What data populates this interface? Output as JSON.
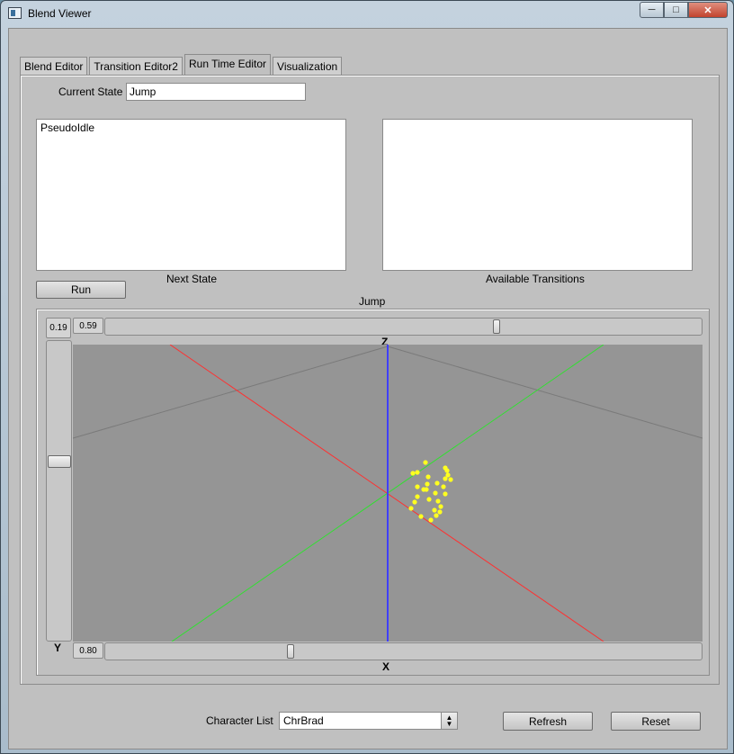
{
  "window": {
    "title": "Blend Viewer",
    "controls": {
      "minimize": "─",
      "maximize": "□",
      "close": "✕"
    }
  },
  "tabs": [
    {
      "label": "Blend Editor",
      "active": false
    },
    {
      "label": "Transition Editor2",
      "active": false
    },
    {
      "label": "Run Time Editor",
      "active": true
    },
    {
      "label": "Visualization",
      "active": false
    }
  ],
  "run_time_editor": {
    "current_state_label": "Current State",
    "current_state_value": "Jump",
    "next_state_list": [
      "PseudoIdle"
    ],
    "next_state_label": "Next State",
    "available_transitions_list": [],
    "available_transitions_label": "Available Transitions",
    "run_button": "Run",
    "viewer_title": "Jump",
    "viewer": {
      "top_left_value": "0.19",
      "z_slider_value": "0.59",
      "z_slider_level": 0.66,
      "y_slider_level": 0.4,
      "x_slider_value": "0.80",
      "x_slider_level": 0.31,
      "axis_z_label": "Z",
      "axis_y_label": "Y",
      "axis_x_label": "X",
      "colors": {
        "background": "#959595",
        "x_axis": "#ff3030",
        "y_axis": "#30e030",
        "z_axis": "#4040ff",
        "points": "#ffff20",
        "grid": "#7a7a7a"
      }
    }
  },
  "footer": {
    "character_list_label": "Character List",
    "character_list_value": "ChrBrad",
    "refresh_button": "Refresh",
    "reset_button": "Reset"
  }
}
